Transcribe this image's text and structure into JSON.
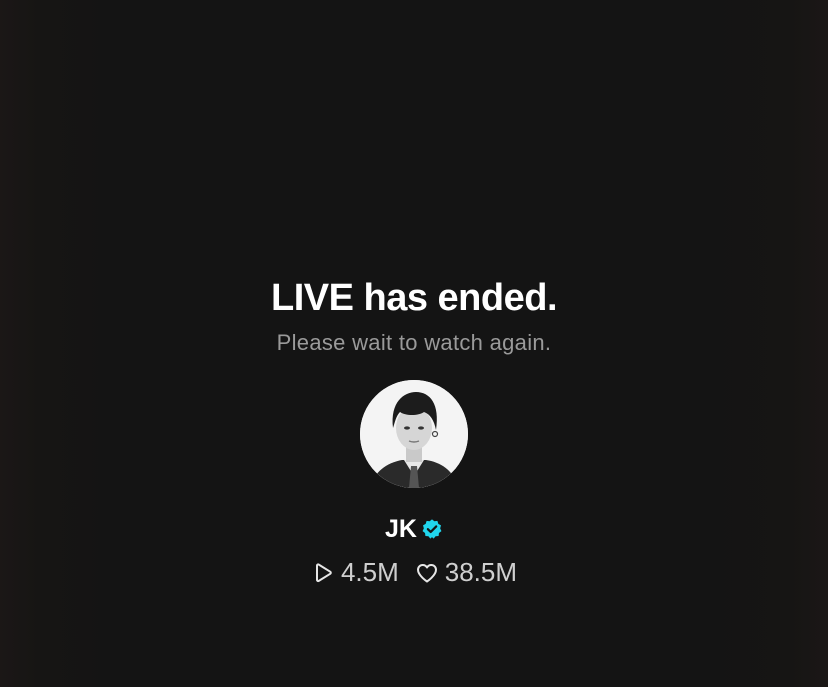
{
  "live_end": {
    "title": "LIVE has ended.",
    "subtitle": "Please wait to watch again."
  },
  "creator": {
    "name": "JK",
    "verified": true,
    "verified_color": "#20D5EC"
  },
  "stats": {
    "views": "4.5M",
    "likes": "38.5M",
    "views_icon": "play-icon",
    "likes_icon": "heart-icon"
  }
}
